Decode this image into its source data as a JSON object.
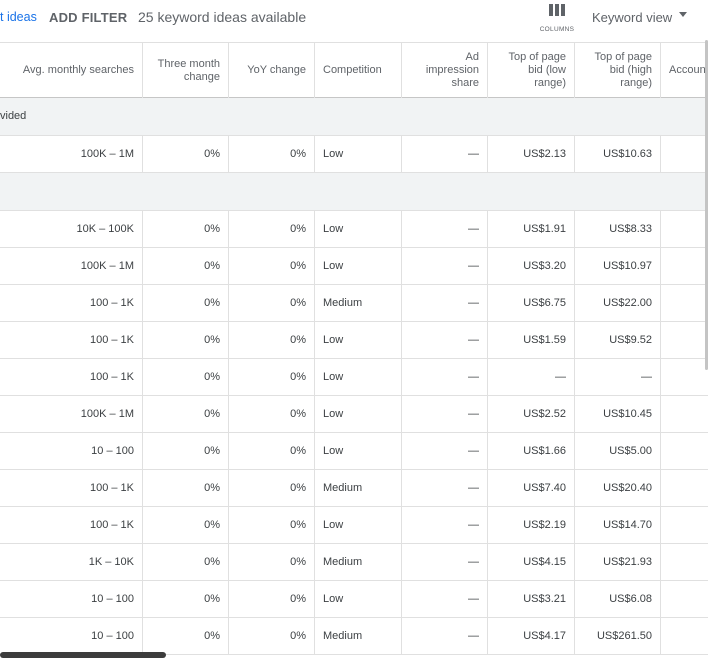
{
  "toolbar": {
    "ideas_link": "t ideas",
    "add_filter": "ADD FILTER",
    "keyword_count": "25 keyword ideas available",
    "columns_label": "COLUMNS",
    "view_label": "Keyword view"
  },
  "columns": [
    "Avg. monthly searches",
    "Three month change",
    "YoY change",
    "Competition",
    "Ad impression share",
    "Top of page bid (low range)",
    "Top of page bid (high range)",
    "Accoun"
  ],
  "sections": [
    {
      "label": "vided"
    },
    {
      "label": ""
    }
  ],
  "rows": [
    [
      "100K – 1M",
      "0%",
      "0%",
      "Low",
      "—",
      "US$2.13",
      "US$10.63"
    ],
    [
      "10K – 100K",
      "0%",
      "0%",
      "Low",
      "—",
      "US$1.91",
      "US$8.33"
    ],
    [
      "100K – 1M",
      "0%",
      "0%",
      "Low",
      "—",
      "US$3.20",
      "US$10.97"
    ],
    [
      "100 – 1K",
      "0%",
      "0%",
      "Medium",
      "—",
      "US$6.75",
      "US$22.00"
    ],
    [
      "100 – 1K",
      "0%",
      "0%",
      "Low",
      "—",
      "US$1.59",
      "US$9.52"
    ],
    [
      "100 – 1K",
      "0%",
      "0%",
      "Low",
      "—",
      "—",
      "—"
    ],
    [
      "100K – 1M",
      "0%",
      "0%",
      "Low",
      "—",
      "US$2.52",
      "US$10.45"
    ],
    [
      "10 – 100",
      "0%",
      "0%",
      "Low",
      "—",
      "US$1.66",
      "US$5.00"
    ],
    [
      "100 – 1K",
      "0%",
      "0%",
      "Medium",
      "—",
      "US$7.40",
      "US$20.40"
    ],
    [
      "100 – 1K",
      "0%",
      "0%",
      "Low",
      "—",
      "US$2.19",
      "US$14.70"
    ],
    [
      "1K – 10K",
      "0%",
      "0%",
      "Medium",
      "—",
      "US$4.15",
      "US$21.93"
    ],
    [
      "10 – 100",
      "0%",
      "0%",
      "Low",
      "—",
      "US$3.21",
      "US$6.08"
    ],
    [
      "10 – 100",
      "0%",
      "0%",
      "Medium",
      "—",
      "US$4.17",
      "US$261.50"
    ]
  ],
  "colors": {
    "link": "#1a73e8",
    "muted_text": "#5f6368",
    "body_text": "#3c4043",
    "section_bg": "#f1f3f4",
    "grid": "#e0e0e0"
  }
}
